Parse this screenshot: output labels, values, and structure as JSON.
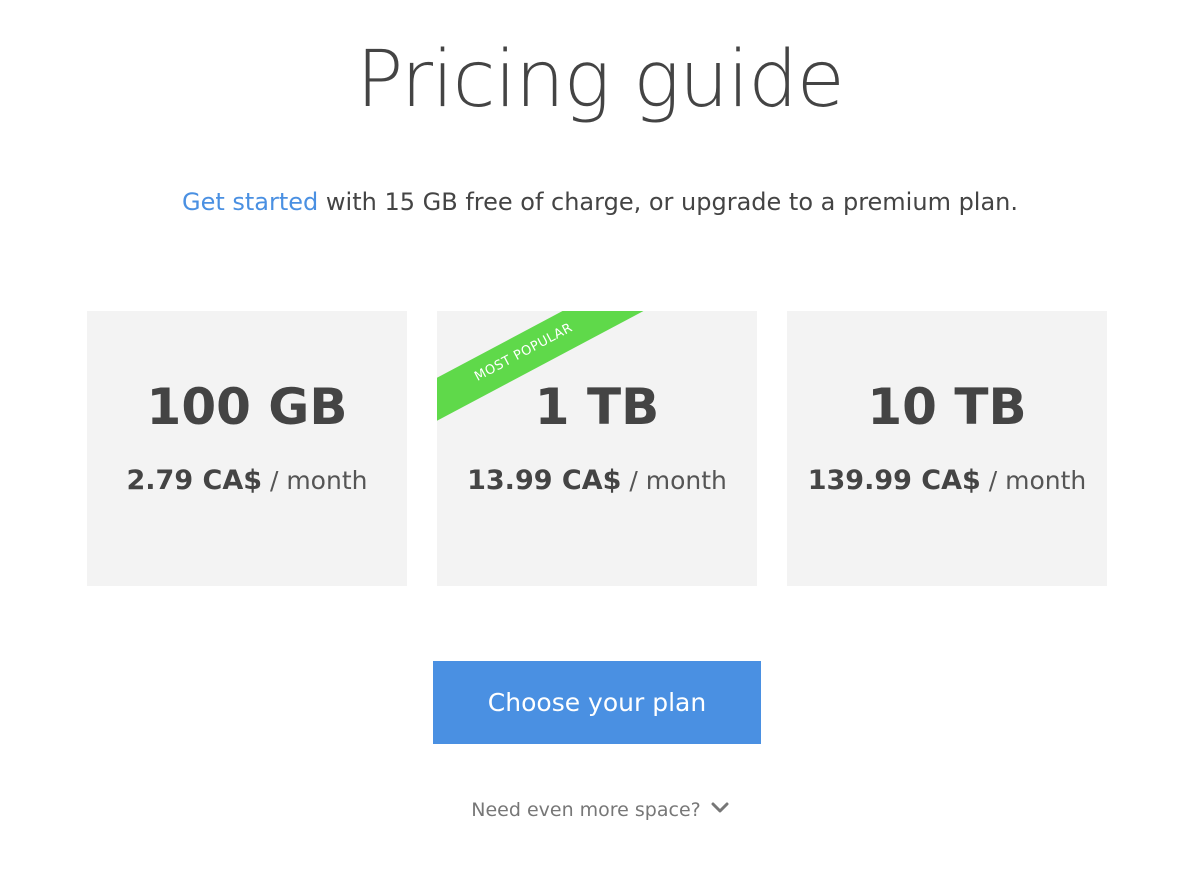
{
  "header": {
    "title": "Pricing guide"
  },
  "intro": {
    "link_text": "Get started",
    "text": " with 15 GB free of charge, or upgrade to a premium plan."
  },
  "plans": [
    {
      "storage": "100 GB",
      "price": "2.79 CA$",
      "period": " / month"
    },
    {
      "storage": "1 TB",
      "price": "13.99 CA$",
      "period": " / month",
      "ribbon": "MOST POPULAR"
    },
    {
      "storage": "10 TB",
      "price": "139.99 CA$",
      "period": " / month"
    }
  ],
  "cta": {
    "label": "Choose your plan"
  },
  "more": {
    "label": "Need even more space?",
    "icon": "chevron-down-icon"
  },
  "colors": {
    "accent": "#4a90e2",
    "ribbon": "#5fd94a",
    "card_bg": "#f3f3f3",
    "text": "#444444"
  }
}
